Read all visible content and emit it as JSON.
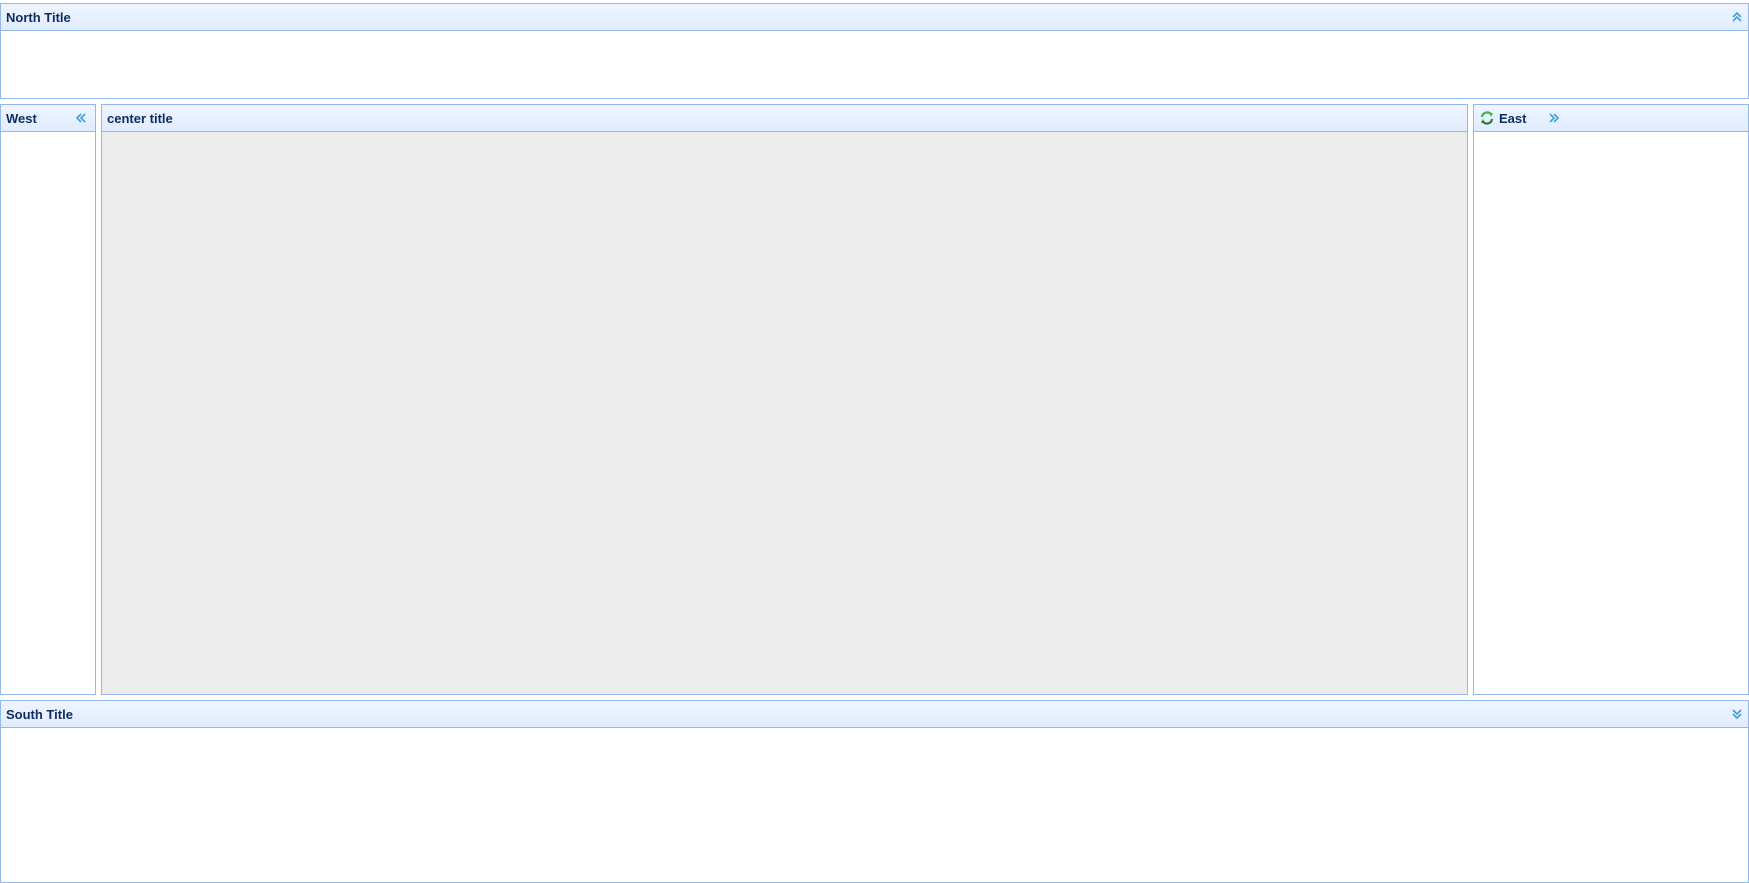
{
  "north": {
    "title": "North Title",
    "collapse_icon": "collapse-up-icon"
  },
  "west": {
    "title": "West",
    "collapse_icon": "collapse-left-icon"
  },
  "center": {
    "title": "center title"
  },
  "east": {
    "title": "East",
    "title_icon": "refresh-icon",
    "collapse_icon": "collapse-right-icon"
  },
  "south": {
    "title": "South Title",
    "collapse_icon": "collapse-down-icon"
  },
  "colors": {
    "border": "#95b8e7",
    "header_top": "#eff5ff",
    "header_bottom": "#e0ecff",
    "title_text": "#0e2d5f",
    "tool_icon": "#3e9fd9",
    "center_background": "#ececec"
  }
}
